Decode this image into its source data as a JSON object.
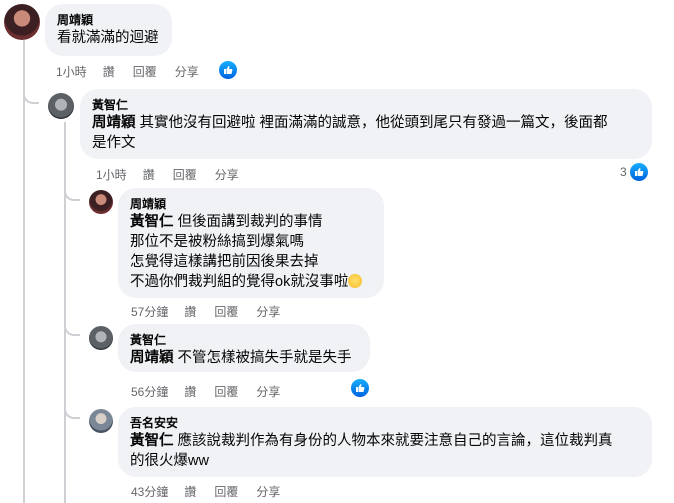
{
  "comments": [
    {
      "author": "周靖穎",
      "mention": "",
      "lines": [
        "看就滿滿的迴避"
      ],
      "time": "1小時",
      "like": "讚",
      "reply": "回覆",
      "share": "分享",
      "reaction_count": ""
    },
    {
      "author": "黃智仁",
      "mention": "周靖穎",
      "lines": [
        " 其實他沒有回避啦 裡面滿滿的誠意，他從頭到尾只有發過一篇文，後面都",
        "是作文"
      ],
      "time": "1小時",
      "like": "讚",
      "reply": "回覆",
      "share": "分享",
      "reaction_count": "3"
    },
    {
      "author": "周靖穎",
      "mention": "黃智仁",
      "lines": [
        " 但後面講到裁判的事情",
        "那位不是被粉絲搞到爆氣嗎",
        "怎覺得這樣講把前因後果去掉",
        "不過你們裁判組的覺得ok就沒事啦"
      ],
      "time": "57分鐘",
      "like": "讚",
      "reply": "回覆",
      "share": "分享",
      "reaction_count": ""
    },
    {
      "author": "黃智仁",
      "mention": "周靖穎",
      "lines": [
        " 不管怎樣被搞失手就是失手"
      ],
      "time": "56分鐘",
      "like": "讚",
      "reply": "回覆",
      "share": "分享",
      "reaction_count": ""
    },
    {
      "author": "吾名安安",
      "mention": "黃智仁",
      "lines": [
        " 應該說裁判作為有身份的人物本來就要注意自己的言論，這位裁判真",
        "的很火爆ww"
      ],
      "time": "43分鐘",
      "like": "讚",
      "reply": "回覆",
      "share": "分享",
      "reaction_count": ""
    }
  ],
  "colors": {
    "bubble": "#f0f2f5",
    "meta": "#65676b",
    "like_blue": "#0866ff"
  }
}
